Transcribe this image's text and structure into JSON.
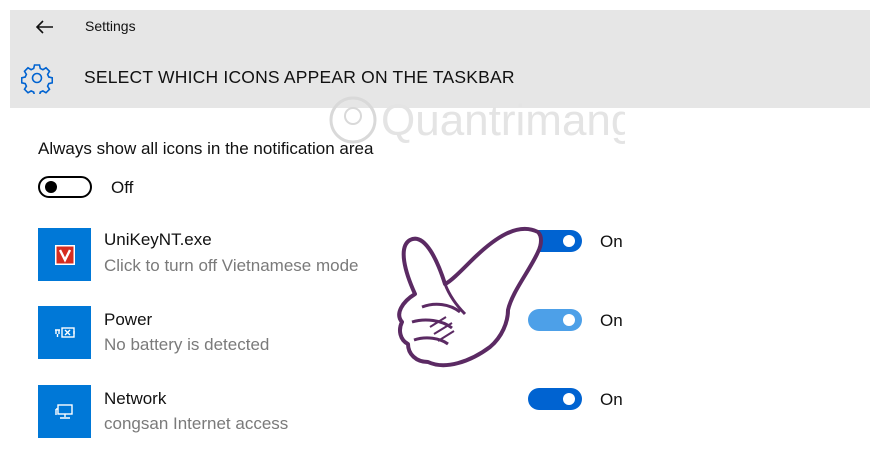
{
  "header": {
    "app_title": "Settings",
    "page_title": "SELECT WHICH ICONS APPEAR ON THE TASKBAR",
    "back_icon": "arrow-left-icon",
    "page_icon": "gear-icon"
  },
  "always_show": {
    "label": "Always show all icons in the notification area",
    "state": "Off"
  },
  "items": [
    {
      "name": "UniKeyNT.exe",
      "description": "Click to turn off Vietnamese mode",
      "state": "On",
      "icon": "unikey-icon"
    },
    {
      "name": "Power",
      "description": "No battery is detected",
      "state": "On",
      "icon": "battery-icon"
    },
    {
      "name": "Network",
      "description": "congsan Internet access",
      "state": "On",
      "icon": "network-icon"
    }
  ],
  "watermark": {
    "text": "Quantrimang"
  },
  "colors": {
    "accent": "#0063d1",
    "accent_light": "#4da0e8",
    "tile": "#0078d7",
    "header_bg": "#e6e6e6",
    "secondary_text": "#7a7a7a",
    "hand_outline": "#5b2a63"
  }
}
